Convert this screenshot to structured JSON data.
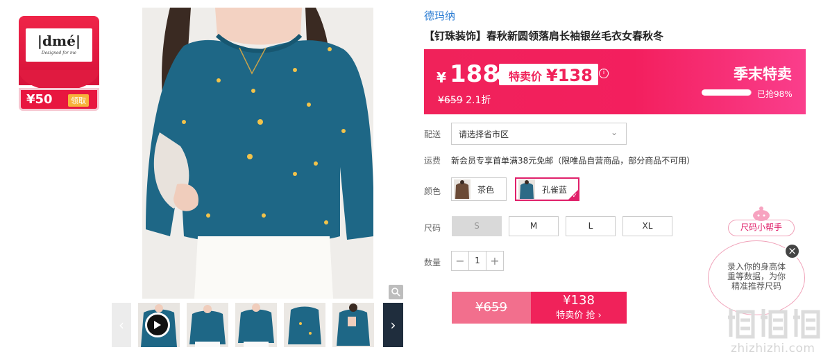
{
  "coupon": {
    "brand_logo_text": "|dmé|",
    "brand_tagline": "Designed for me",
    "amount": "¥50",
    "claim_label": "领取"
  },
  "product": {
    "brand": "德玛纳",
    "title": "【钉珠装饰】春秋新圆领落肩长袖银丝毛衣女春秋冬"
  },
  "promo": {
    "currency": "¥",
    "price": "188",
    "special_label": "特卖价",
    "special_price": "¥138",
    "info_icon": "i",
    "original_price": "¥659",
    "discount": "2.1折",
    "season_label": "季末特卖",
    "sold_progress": 0.98,
    "sold_text": "已抢98%",
    "colors": {
      "accent": "#f0225a",
      "accent_light": "#fa3e8c"
    }
  },
  "shipping": {
    "label": "配送",
    "select_value": "请选择省市区"
  },
  "fee": {
    "label": "运费",
    "text": "新会员专享首单满38元免邮（限唯品自营商品，部分商品不可用）"
  },
  "color": {
    "label": "颜色",
    "options": [
      {
        "name": "茶色",
        "selected": false,
        "swatch": "#6b4a36"
      },
      {
        "name": "孔雀蓝",
        "selected": true,
        "swatch": "#2c6a86"
      }
    ]
  },
  "size": {
    "label": "尺码",
    "options": [
      {
        "name": "S",
        "disabled": true
      },
      {
        "name": "M",
        "disabled": false
      },
      {
        "name": "L",
        "disabled": false
      },
      {
        "name": "XL",
        "disabled": false
      }
    ]
  },
  "quantity": {
    "label": "数量",
    "minus": "−",
    "value": "1",
    "plus": "+"
  },
  "buy": {
    "original_price": "¥659",
    "price": "¥138",
    "action_label": "特卖价 抢 ›"
  },
  "size_helper": {
    "tag": "尺码小帮手",
    "bubble_text": "录入你的身高体重等数据，为你精准推荐尺码",
    "close_label": "×"
  },
  "watermark": {
    "url": "zhizhizhi.com"
  }
}
